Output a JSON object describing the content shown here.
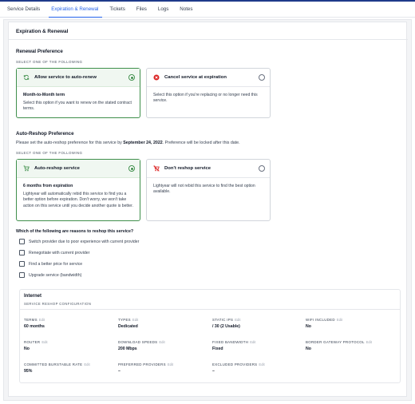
{
  "tabs": [
    {
      "label": "Service Details",
      "active": false
    },
    {
      "label": "Expiration & Renewal",
      "active": true
    },
    {
      "label": "Tickets",
      "active": false
    },
    {
      "label": "Files",
      "active": false
    },
    {
      "label": "Logs",
      "active": false
    },
    {
      "label": "Notes",
      "active": false
    }
  ],
  "panel": {
    "title": "Expiration & Renewal"
  },
  "renewal": {
    "title": "Renewal Preference",
    "select_label": "SELECT ONE OF THE FOLLOWING",
    "options": [
      {
        "title": "Allow service to auto-renew",
        "icon": "refresh-icon",
        "selected": true,
        "subtitle": "Month-to-Month term",
        "text": "Select this option if you want to renew on the stated contract terms."
      },
      {
        "title": "Cancel service at expiration",
        "icon": "cancel-icon",
        "selected": false,
        "subtitle": "",
        "text": "Select this option if you're replacing or no longer need this service."
      }
    ]
  },
  "reshop": {
    "title": "Auto-Reshop Preference",
    "desc_prefix": "Please set the auto-reshop preference for this service by ",
    "desc_date": "September 24, 2022",
    "desc_suffix": ". Preference will be locked after this date.",
    "select_label": "SELECT ONE OF THE FOLLOWING",
    "options": [
      {
        "title": "Auto-reshop service",
        "icon": "cart-icon",
        "selected": true,
        "subtitle": "6 months from expiration",
        "text": "Lightyear will automatically rebid this service to find you a better option before expiration. Don't worry, we won't take action on this service until you decide another quote is better."
      },
      {
        "title": "Don't reshop service",
        "icon": "cart-off-icon",
        "selected": false,
        "subtitle": "",
        "text": "Lightyear will not rebid this service to find the best option available."
      }
    ]
  },
  "reasons": {
    "question": "Which of the following are reasons to reshop this service?",
    "items": [
      {
        "label": "Switch provider due to poor experience with current provider",
        "checked": false
      },
      {
        "label": "Renegotiate with current provider",
        "checked": false
      },
      {
        "label": "Find a better price for service",
        "checked": false
      },
      {
        "label": "Upgrade service (bandwidth)",
        "checked": false
      }
    ]
  },
  "config": {
    "title": "Internet",
    "subtitle": "SERVICE RESHOP CONFIGURATION",
    "edit_label": "Edit",
    "fields": [
      {
        "label": "TERMS",
        "value": "60 months"
      },
      {
        "label": "TYPES",
        "value": "Dedicated"
      },
      {
        "label": "STATIC IPS",
        "value": "/ 30 (2 Usable)"
      },
      {
        "label": "WIFI INCLUDED",
        "value": "No"
      },
      {
        "label": "ROUTER",
        "value": "No"
      },
      {
        "label": "DOWNLOAD SPEEDS",
        "value": "200 Mbps"
      },
      {
        "label": "FIXED BANDWIDTH",
        "value": "Fixed"
      },
      {
        "label": "BORDER GATEWAY PROTOCOL",
        "value": "No"
      },
      {
        "label": "COMMITTED BURSTABLE RATE",
        "value": "95%"
      },
      {
        "label": "PREFERRED PROVIDERS",
        "value": "–"
      },
      {
        "label": "EXCLUDED PROVIDERS",
        "value": "–"
      }
    ]
  },
  "colors": {
    "accent": "#2563eb",
    "selected": "#3f8f4b",
    "danger": "#dc2626",
    "brand_line": "#1f3a8a"
  }
}
